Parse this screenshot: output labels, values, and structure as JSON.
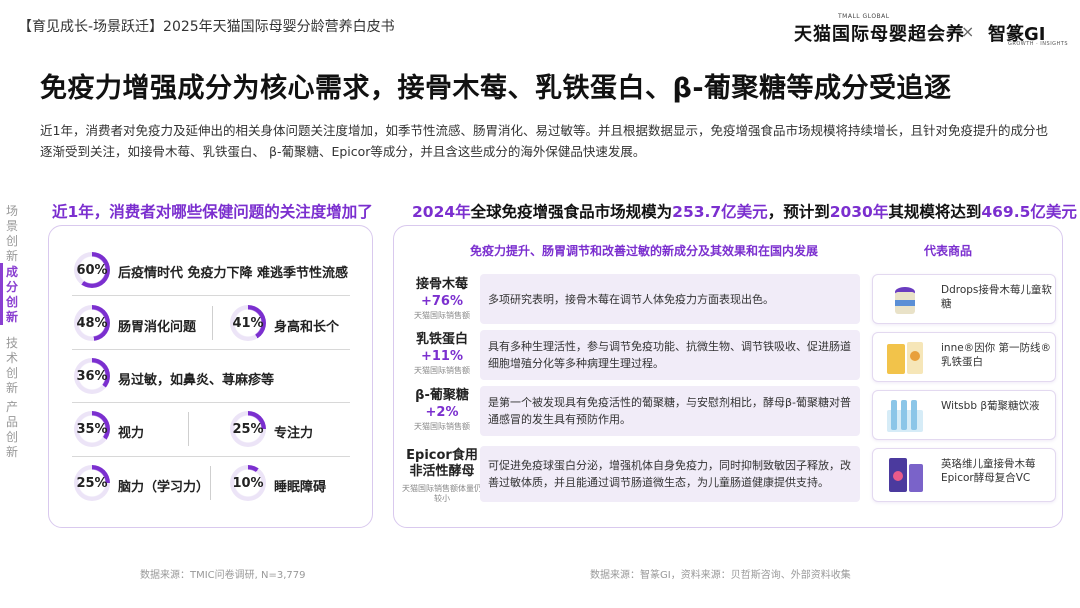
{
  "header": {
    "title": "【育见成长-场景跃迁】2025年天猫国际母婴分龄营养白皮书",
    "brand_small": "TMALL GLOBAL",
    "brand": "天猫国际母婴超会养",
    "separator": "×",
    "partner": "智篆GI",
    "partner_small": "GROWTH · INSIGHTS"
  },
  "main_title": "免疫力增强成分为核心需求，接骨木莓、乳铁蛋白、β-葡聚糖等成分受追逐",
  "intro": "近1年，消费者对免疫力及延伸出的相关身体问题关注度增加，如季节性流感、肠胃消化、易过敏等。并且根据数据显示，免疫增强食品市场规模将持续增长，且针对免疫提升的成分也逐渐受到关注，如接骨木莓、乳铁蛋白、 β-葡聚糖、Epicor等成分，并且含这些成分的海外保健品快速发展。",
  "nav": {
    "items": [
      {
        "label": "场景创新"
      },
      {
        "label": "成分创新"
      },
      {
        "label": "技术创新"
      },
      {
        "label": "产品创新"
      }
    ],
    "active_color": "#8a3fd1"
  },
  "left_section": {
    "heading": "近1年，消费者对哪些保健问题的关注度增加了",
    "concerns": [
      {
        "pct": "60%",
        "value": 60,
        "label": "后疫情时代 免疫力下降 难逃季节性流感"
      },
      {
        "pct": "48%",
        "value": 48,
        "label": "肠胃消化问题"
      },
      {
        "pct": "41%",
        "value": 41,
        "label": "身高和长个"
      },
      {
        "pct": "36%",
        "value": 36,
        "label": "易过敏，如鼻炎、荨麻疹等"
      },
      {
        "pct": "35%",
        "value": 35,
        "label": "视力"
      },
      {
        "pct": "25%",
        "value": 25,
        "label": "专注力"
      },
      {
        "pct": "25%",
        "value": 25,
        "label": "脑力（学习力）"
      },
      {
        "pct": "10%",
        "value": 10,
        "label": "睡眠障碍"
      }
    ],
    "source": "数据来源：TMIC问卷调研, N=3,779"
  },
  "right_section": {
    "heading_parts": {
      "p1": "2024年",
      "p2": "全球免疫增强食品市场规模为",
      "p3": "253.7亿美元",
      "p4": "，预计到",
      "p5": "2030年",
      "p6": "其规模将达到",
      "p7": "469.5亿美元"
    },
    "table_heading": "免疫力提升、肠胃调节和改善过敏的新成分及其效果和在国内发展",
    "products_heading": "代表商品",
    "ingredients": [
      {
        "name": "接骨木莓",
        "growth": "+76%",
        "source": "天猫国际销售额",
        "desc": "多项研究表明，接骨木莓在调节人体免疫力方面表现出色。",
        "product": "Ddrops接骨木莓儿童软糖"
      },
      {
        "name": "乳铁蛋白",
        "growth": "+11%",
        "source": "天猫国际销售额",
        "desc": "具有多种生理活性，参与调节免疫功能、抗微生物、调节铁吸收、促进肠道细胞增殖分化等多种病理生理过程。",
        "product": "inne®因你 第一防线®乳铁蛋白"
      },
      {
        "name": "β-葡聚糖",
        "growth": "+2%",
        "source": "天猫国际销售额",
        "desc": "是第一个被发现具有免疫活性的葡聚糖，与安慰剂相比，酵母β-葡聚糖对普通感冒的发生具有预防作用。",
        "product": "Witsbb β葡聚糖饮液"
      },
      {
        "name": "Epicor食用非活性酵母",
        "growth": "",
        "source": "天猫国际销售额体量仍较小",
        "desc": "可促进免疫球蛋白分泌，增强机体自身免疫力，同时抑制致敏因子释放，改善过敏体质，并且能通过调节肠道微生态，为儿童肠道健康提供支持。",
        "product": "英珞维儿童接骨木莓Epicor酵母复合VC"
      }
    ],
    "source": "数据来源：智篆GI，资料来源：贝哲斯咨询、外部资料收集"
  },
  "colors": {
    "accent": "#7b2fcf",
    "accent_light": "#b48ae6",
    "panel_border": "#d9c9ee",
    "desc_bg": "#f1ecf8"
  }
}
